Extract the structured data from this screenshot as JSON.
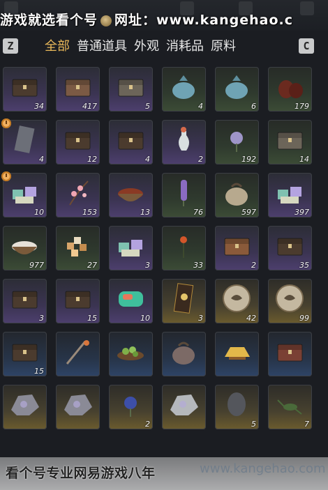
{
  "watermark_top": {
    "part1": "游戏就选看个号",
    "part2": "网址：www.kangehao.c"
  },
  "top_icons": [
    "Q",
    "E"
  ],
  "keys": {
    "left": "Z",
    "right": "C"
  },
  "tabs": [
    "全部",
    "普通道具",
    "外观",
    "消耗品",
    "原料"
  ],
  "active_tab": "全部",
  "rows": [
    [
      {
        "icon": "chest-dark-icon",
        "count": "34",
        "tint": "purple"
      },
      {
        "icon": "chest-carved-icon",
        "count": "417",
        "tint": "purple"
      },
      {
        "icon": "chest-grey-icon",
        "count": "5",
        "tint": "purple"
      },
      {
        "icon": "cloth-bundle-icon",
        "count": "4",
        "tint": "green"
      },
      {
        "icon": "cloth-bundle-icon",
        "count": "6",
        "tint": "green"
      },
      {
        "icon": "wine-jar-icon",
        "count": "179",
        "tint": "green"
      }
    ],
    [
      {
        "icon": "talisman-icon",
        "count": "4",
        "tint": "purple",
        "clock": true
      },
      {
        "icon": "chest-open-icon",
        "count": "12",
        "tint": "purple"
      },
      {
        "icon": "chest-brown-icon",
        "count": "4",
        "tint": "purple"
      },
      {
        "icon": "vase-icon",
        "count": "2",
        "tint": "purple"
      },
      {
        "icon": "flower-purple-icon",
        "count": "192",
        "tint": "green"
      },
      {
        "icon": "chest-grey-icon",
        "count": "14",
        "tint": "green"
      }
    ],
    [
      {
        "icon": "gift-box-icon",
        "count": "10",
        "tint": "purple",
        "clock": true
      },
      {
        "icon": "blossom-icon",
        "count": "153",
        "tint": "purple"
      },
      {
        "icon": "food-bowl-icon",
        "count": "13",
        "tint": "purple"
      },
      {
        "icon": "lavender-icon",
        "count": "76",
        "tint": "green"
      },
      {
        "icon": "grain-sack-icon",
        "count": "597",
        "tint": "green"
      },
      {
        "icon": "gift-box-icon",
        "count": "397",
        "tint": "purple"
      }
    ],
    [
      {
        "icon": "rice-bowl-icon",
        "count": "977",
        "tint": "green"
      },
      {
        "icon": "candy-pile-icon",
        "count": "27",
        "tint": "green"
      },
      {
        "icon": "gift-box-icon",
        "count": "3",
        "tint": "purple"
      },
      {
        "icon": "red-flower-icon",
        "count": "33",
        "tint": "green"
      },
      {
        "icon": "chest-light-icon",
        "count": "2",
        "tint": "purple"
      },
      {
        "icon": "chest-dark-icon",
        "count": "35",
        "tint": "purple"
      }
    ],
    [
      {
        "icon": "tool-box-icon",
        "count": "3",
        "tint": "purple"
      },
      {
        "icon": "chest-brown-icon",
        "count": "15",
        "tint": "purple"
      },
      {
        "icon": "jade-stone-icon",
        "count": "10",
        "tint": "purple"
      },
      {
        "icon": "scroll-panel-icon",
        "count": "3",
        "tint": "gold"
      },
      {
        "icon": "bird-coin-icon",
        "count": "42",
        "tint": "gold"
      },
      {
        "icon": "bird-coin-icon",
        "count": "99",
        "tint": "gold"
      }
    ],
    [
      {
        "icon": "chest-brown-icon",
        "count": "15",
        "tint": "blue"
      },
      {
        "icon": "staff-lantern-icon",
        "count": "",
        "tint": "blue"
      },
      {
        "icon": "fruit-plate-icon",
        "count": "",
        "tint": "blue"
      },
      {
        "icon": "pouch-icon",
        "count": "",
        "tint": "blue"
      },
      {
        "icon": "gold-ingot-icon",
        "count": "",
        "tint": "blue"
      },
      {
        "icon": "ornate-box-icon",
        "count": "",
        "tint": "blue"
      }
    ],
    [
      {
        "icon": "ore-rock-icon",
        "count": "",
        "tint": "gold"
      },
      {
        "icon": "ore-rock-icon",
        "count": "",
        "tint": "gold"
      },
      {
        "icon": "blue-flower-icon",
        "count": "2",
        "tint": "gold"
      },
      {
        "icon": "silver-ore-icon",
        "count": "",
        "tint": "gold"
      },
      {
        "icon": "dark-stone-icon",
        "count": "5",
        "tint": "gold"
      },
      {
        "icon": "cricket-icon",
        "count": "7",
        "tint": "gold"
      }
    ]
  ],
  "watermark_bottom": {
    "left": "看个号专业网易游戏八年",
    "right": "www.kangehao.com"
  },
  "colors": {
    "accent": "#e9b85a",
    "background": "#1b1d22"
  }
}
